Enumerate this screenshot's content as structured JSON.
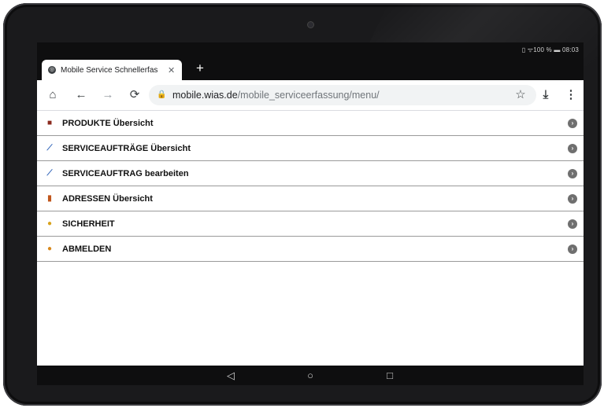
{
  "status": {
    "text": "▯ ᯤ100 % ▬ 08:03"
  },
  "tab": {
    "title": "Mobile Service Schnellerfas",
    "close": "✕",
    "favicon": "globe-icon"
  },
  "new_tab": "+",
  "toolbar": {
    "home": "⌂",
    "back": "←",
    "forward": "→",
    "reload": "⟳",
    "star": "☆",
    "download": "⤓",
    "menu": "⋮"
  },
  "address": {
    "domain": "mobile.wias.de",
    "path": "/mobile_serviceerfassung/menu/"
  },
  "menu": {
    "items": [
      {
        "label": "PRODUKTE Übersicht",
        "icon": "product-icon",
        "glyph": "■",
        "color": "#8b2a1e"
      },
      {
        "label": "SERVICEAUFTRÄGE Übersicht",
        "icon": "wrench-icon",
        "glyph": "⟋",
        "color": "#2f63b8"
      },
      {
        "label": "SERVICEAUFTRAG bearbeiten",
        "icon": "wrench-icon",
        "glyph": "⟋",
        "color": "#2f63b8"
      },
      {
        "label": "ADRESSEN Übersicht",
        "icon": "address-book-icon",
        "glyph": "▮",
        "color": "#c0561c"
      },
      {
        "label": "SICHERHEIT",
        "icon": "security-user-icon",
        "glyph": "●",
        "color": "#d8a21c"
      },
      {
        "label": "ABMELDEN",
        "icon": "logout-user-icon",
        "glyph": "●",
        "color": "#d8881c"
      }
    ],
    "arrow": "›"
  },
  "navbar": {
    "back": "◁",
    "home": "○",
    "recents": "□"
  }
}
